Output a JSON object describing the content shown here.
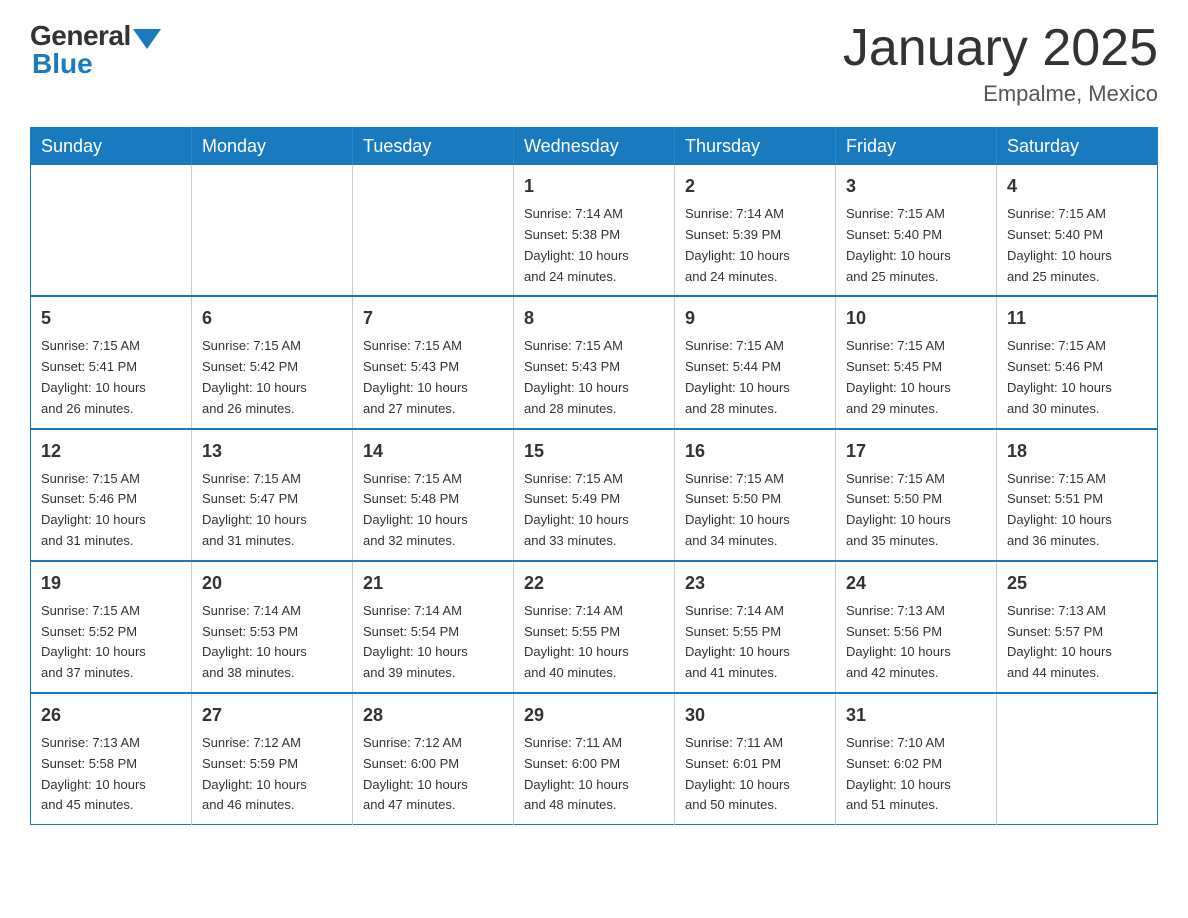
{
  "header": {
    "logo_general": "General",
    "logo_blue": "Blue",
    "month_title": "January 2025",
    "location": "Empalme, Mexico"
  },
  "days_of_week": [
    "Sunday",
    "Monday",
    "Tuesday",
    "Wednesday",
    "Thursday",
    "Friday",
    "Saturday"
  ],
  "weeks": [
    [
      {
        "day": "",
        "info": ""
      },
      {
        "day": "",
        "info": ""
      },
      {
        "day": "",
        "info": ""
      },
      {
        "day": "1",
        "info": "Sunrise: 7:14 AM\nSunset: 5:38 PM\nDaylight: 10 hours\nand 24 minutes."
      },
      {
        "day": "2",
        "info": "Sunrise: 7:14 AM\nSunset: 5:39 PM\nDaylight: 10 hours\nand 24 minutes."
      },
      {
        "day": "3",
        "info": "Sunrise: 7:15 AM\nSunset: 5:40 PM\nDaylight: 10 hours\nand 25 minutes."
      },
      {
        "day": "4",
        "info": "Sunrise: 7:15 AM\nSunset: 5:40 PM\nDaylight: 10 hours\nand 25 minutes."
      }
    ],
    [
      {
        "day": "5",
        "info": "Sunrise: 7:15 AM\nSunset: 5:41 PM\nDaylight: 10 hours\nand 26 minutes."
      },
      {
        "day": "6",
        "info": "Sunrise: 7:15 AM\nSunset: 5:42 PM\nDaylight: 10 hours\nand 26 minutes."
      },
      {
        "day": "7",
        "info": "Sunrise: 7:15 AM\nSunset: 5:43 PM\nDaylight: 10 hours\nand 27 minutes."
      },
      {
        "day": "8",
        "info": "Sunrise: 7:15 AM\nSunset: 5:43 PM\nDaylight: 10 hours\nand 28 minutes."
      },
      {
        "day": "9",
        "info": "Sunrise: 7:15 AM\nSunset: 5:44 PM\nDaylight: 10 hours\nand 28 minutes."
      },
      {
        "day": "10",
        "info": "Sunrise: 7:15 AM\nSunset: 5:45 PM\nDaylight: 10 hours\nand 29 minutes."
      },
      {
        "day": "11",
        "info": "Sunrise: 7:15 AM\nSunset: 5:46 PM\nDaylight: 10 hours\nand 30 minutes."
      }
    ],
    [
      {
        "day": "12",
        "info": "Sunrise: 7:15 AM\nSunset: 5:46 PM\nDaylight: 10 hours\nand 31 minutes."
      },
      {
        "day": "13",
        "info": "Sunrise: 7:15 AM\nSunset: 5:47 PM\nDaylight: 10 hours\nand 31 minutes."
      },
      {
        "day": "14",
        "info": "Sunrise: 7:15 AM\nSunset: 5:48 PM\nDaylight: 10 hours\nand 32 minutes."
      },
      {
        "day": "15",
        "info": "Sunrise: 7:15 AM\nSunset: 5:49 PM\nDaylight: 10 hours\nand 33 minutes."
      },
      {
        "day": "16",
        "info": "Sunrise: 7:15 AM\nSunset: 5:50 PM\nDaylight: 10 hours\nand 34 minutes."
      },
      {
        "day": "17",
        "info": "Sunrise: 7:15 AM\nSunset: 5:50 PM\nDaylight: 10 hours\nand 35 minutes."
      },
      {
        "day": "18",
        "info": "Sunrise: 7:15 AM\nSunset: 5:51 PM\nDaylight: 10 hours\nand 36 minutes."
      }
    ],
    [
      {
        "day": "19",
        "info": "Sunrise: 7:15 AM\nSunset: 5:52 PM\nDaylight: 10 hours\nand 37 minutes."
      },
      {
        "day": "20",
        "info": "Sunrise: 7:14 AM\nSunset: 5:53 PM\nDaylight: 10 hours\nand 38 minutes."
      },
      {
        "day": "21",
        "info": "Sunrise: 7:14 AM\nSunset: 5:54 PM\nDaylight: 10 hours\nand 39 minutes."
      },
      {
        "day": "22",
        "info": "Sunrise: 7:14 AM\nSunset: 5:55 PM\nDaylight: 10 hours\nand 40 minutes."
      },
      {
        "day": "23",
        "info": "Sunrise: 7:14 AM\nSunset: 5:55 PM\nDaylight: 10 hours\nand 41 minutes."
      },
      {
        "day": "24",
        "info": "Sunrise: 7:13 AM\nSunset: 5:56 PM\nDaylight: 10 hours\nand 42 minutes."
      },
      {
        "day": "25",
        "info": "Sunrise: 7:13 AM\nSunset: 5:57 PM\nDaylight: 10 hours\nand 44 minutes."
      }
    ],
    [
      {
        "day": "26",
        "info": "Sunrise: 7:13 AM\nSunset: 5:58 PM\nDaylight: 10 hours\nand 45 minutes."
      },
      {
        "day": "27",
        "info": "Sunrise: 7:12 AM\nSunset: 5:59 PM\nDaylight: 10 hours\nand 46 minutes."
      },
      {
        "day": "28",
        "info": "Sunrise: 7:12 AM\nSunset: 6:00 PM\nDaylight: 10 hours\nand 47 minutes."
      },
      {
        "day": "29",
        "info": "Sunrise: 7:11 AM\nSunset: 6:00 PM\nDaylight: 10 hours\nand 48 minutes."
      },
      {
        "day": "30",
        "info": "Sunrise: 7:11 AM\nSunset: 6:01 PM\nDaylight: 10 hours\nand 50 minutes."
      },
      {
        "day": "31",
        "info": "Sunrise: 7:10 AM\nSunset: 6:02 PM\nDaylight: 10 hours\nand 51 minutes."
      },
      {
        "day": "",
        "info": ""
      }
    ]
  ]
}
